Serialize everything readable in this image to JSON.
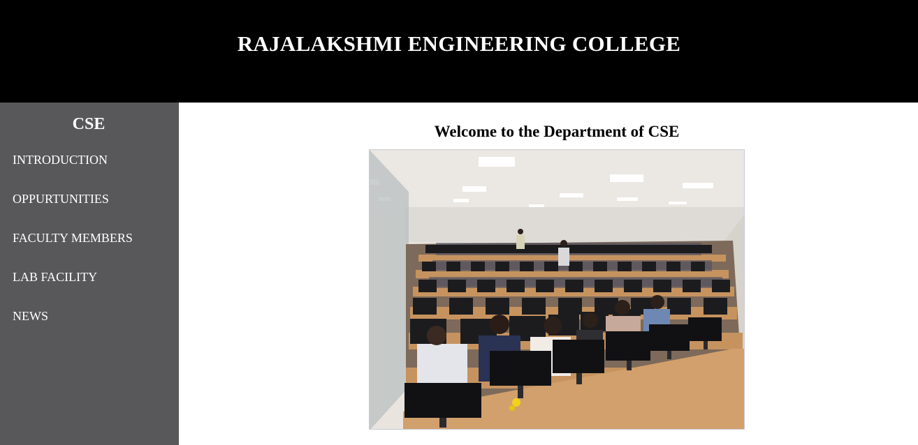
{
  "header": {
    "title": "RAJALAKSHMI ENGINEERING COLLEGE"
  },
  "sidebar": {
    "heading": "CSE",
    "items": [
      {
        "label": "INTRODUCTION"
      },
      {
        "label": "OPPURTUNITIES"
      },
      {
        "label": "FACULTY MEMBERS"
      },
      {
        "label": "LAB FACILITY"
      },
      {
        "label": "NEWS"
      }
    ]
  },
  "main": {
    "heading": "Welcome to the Department of CSE",
    "image": {
      "subject": "computer-lab-photo"
    }
  },
  "colors": {
    "header_bg": "#000000",
    "sidebar_bg": "#58585a",
    "text_light": "#ffffff",
    "text_dark": "#000000"
  }
}
